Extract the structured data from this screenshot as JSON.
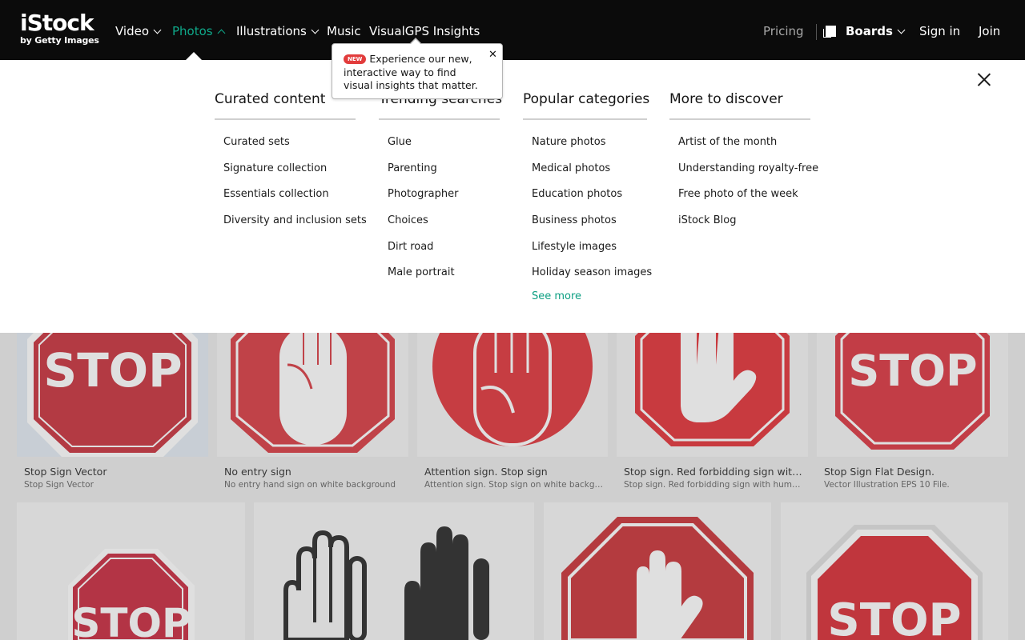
{
  "header": {
    "logo_main": "iStock",
    "logo_sub": "by Getty Images",
    "nav": [
      {
        "label": "Video",
        "chevron": "chevron-down-icon"
      },
      {
        "label": "Photos",
        "chevron": "chevron-up-icon",
        "active": true
      },
      {
        "label": "Illustrations",
        "chevron": "chevron-down-icon"
      },
      {
        "label": "Music"
      },
      {
        "label": "VisualGPS Insights"
      }
    ],
    "pricing": "Pricing",
    "boards": "Boards",
    "sign_in": "Sign in",
    "join": "Join",
    "accent_color": "#0fa98a"
  },
  "popover": {
    "badge": "NEW",
    "text": "Experience our new, interactive way to find visual insights that matter.",
    "close": "✕"
  },
  "menu": {
    "columns": [
      {
        "title": "Curated content",
        "links": [
          "Curated sets",
          "Signature collection",
          "Essentials collection",
          "Diversity and inclusion sets"
        ]
      },
      {
        "title": "Trending searches",
        "links": [
          "Glue",
          "Parenting",
          "Photographer",
          "Choices",
          "Dirt road",
          "Male portrait"
        ]
      },
      {
        "title": "Popular categories",
        "links": [
          "Nature photos",
          "Medical photos",
          "Education photos",
          "Business photos",
          "Lifestyle images",
          "Holiday season images"
        ],
        "see_more": "See more"
      },
      {
        "title": "More to discover",
        "links": [
          "Artist of the month",
          "Understanding royalty-free",
          "Free photo of the week",
          "iStock Blog"
        ]
      }
    ]
  },
  "results": [
    {
      "title": "Stop Sign Vector",
      "subtitle": "Stop Sign Vector"
    },
    {
      "title": "No entry sign",
      "subtitle": "No entry hand sign on white background"
    },
    {
      "title": "Attention sign. Stop sign",
      "subtitle": "Attention sign. Stop sign on white backgr..."
    },
    {
      "title": "Stop sign. Red forbidding sign with ...",
      "subtitle": "Stop sign. Red forbidding sign with huma..."
    },
    {
      "title": "Stop Sign Flat Design.",
      "subtitle": "Vector Illustration EPS 10 File."
    }
  ],
  "stop_word": "STOP",
  "colors": {
    "sign_red": "#cc1a22",
    "dark_red": "#b3151c",
    "white": "#ffffff"
  }
}
